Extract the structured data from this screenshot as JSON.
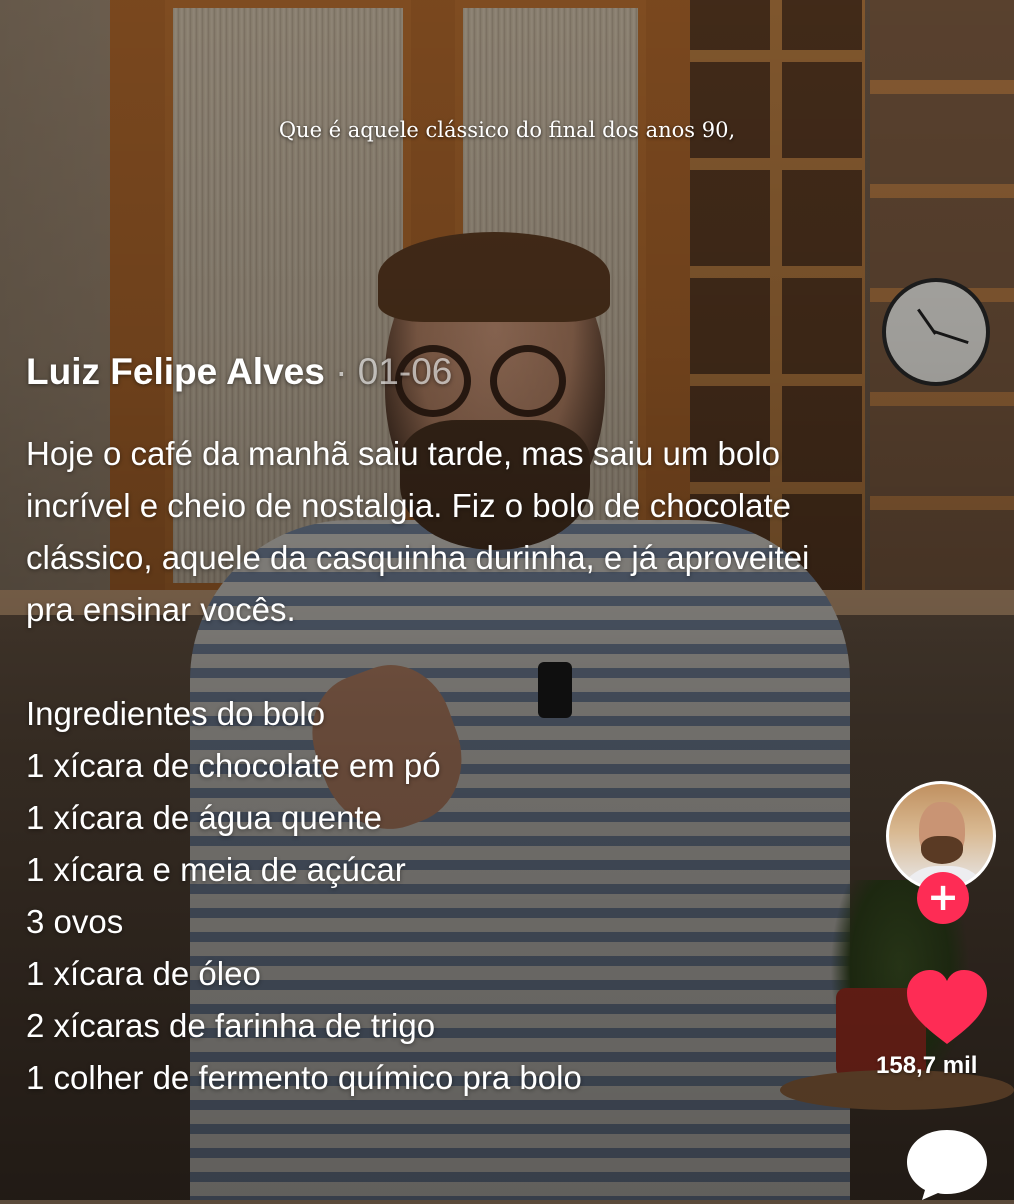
{
  "video": {
    "subtitle": "Que é aquele clássico do final dos anos 90,"
  },
  "post": {
    "author": "Luiz Felipe Alves",
    "separator": "·",
    "date": "01-06",
    "description": "Hoje o café da manhã saiu tarde, mas saiu um bolo incrível e cheio de nostalgia. Fiz o bolo de chocolate clássico, aquele da casquinha durinha, e já aproveitei pra ensinar vocês.",
    "ingredients_title": "Ingredientes do bolo",
    "ingredients": [
      "1 xícara de chocolate em pó",
      "1 xícara de água quente",
      "1 xícara e meia de açúcar",
      "3 ovos",
      "1 xícara de óleo",
      "2 xícaras de farinha de trigo",
      "1 colher de fermento químico pra bolo"
    ]
  },
  "actions": {
    "follow_symbol": "+",
    "like_count": "158,7 mil",
    "like_icon": "heart-icon",
    "comment_icon": "comment-bubble-icon"
  },
  "colors": {
    "accent": "#fe2c55",
    "text": "#ffffff"
  }
}
